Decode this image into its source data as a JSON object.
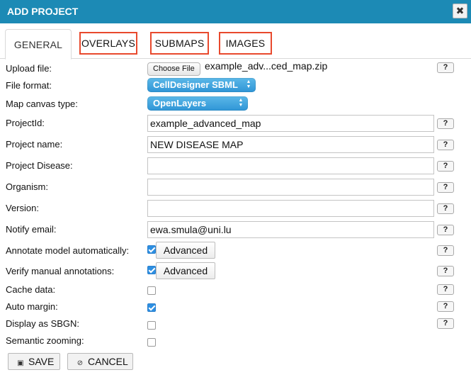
{
  "dialog": {
    "title": "ADD PROJECT",
    "close_glyph": "✖"
  },
  "tabs": [
    {
      "label": "GENERAL",
      "active": true
    },
    {
      "label": "OVERLAYS",
      "highlighted": true
    },
    {
      "label": "SUBMAPS",
      "highlighted": true
    },
    {
      "label": "IMAGES",
      "highlighted": true
    }
  ],
  "help_label": "?",
  "form": {
    "upload": {
      "label": "Upload file:",
      "button": "Choose File",
      "filename": "example_adv...ced_map.zip"
    },
    "format": {
      "label": "File format:",
      "value": "CellDesigner SBML"
    },
    "canvas": {
      "label": "Map canvas type:",
      "value": "OpenLayers"
    },
    "project_id": {
      "label": "ProjectId:",
      "value": "example_advanced_map"
    },
    "project_name": {
      "label": "Project name:",
      "value": "NEW DISEASE MAP"
    },
    "disease": {
      "label": "Project Disease:",
      "value": ""
    },
    "organism": {
      "label": "Organism:",
      "value": ""
    },
    "version": {
      "label": "Version:",
      "value": ""
    },
    "email": {
      "label": "Notify email:",
      "value": "ewa.smula@uni.lu"
    },
    "annotate": {
      "label": "Annotate model automatically:",
      "checked": true,
      "button": "Advanced"
    },
    "verify": {
      "label": "Verify manual annotations:",
      "checked": true,
      "button": "Advanced"
    },
    "cache": {
      "label": "Cache data:",
      "checked": false
    },
    "auto_margin": {
      "label": "Auto margin:",
      "checked": true
    },
    "sbgn": {
      "label": "Display as SBGN:",
      "checked": false
    },
    "semantic": {
      "label": "Semantic zooming:",
      "checked": false
    }
  },
  "actions": {
    "save": {
      "label": "SAVE",
      "icon": "floppy-disk-icon"
    },
    "cancel": {
      "label": "CANCEL",
      "icon": "ban-icon"
    }
  },
  "colors": {
    "titlebar": "#1c8ab5",
    "select": "#3aa0dc",
    "highlight": "#e8492d",
    "checkbox": "#2d8fe2"
  }
}
